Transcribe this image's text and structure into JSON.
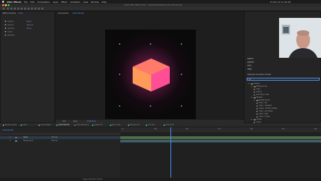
{
  "menubar": {
    "app_name": "After Effects",
    "items": [
      "File",
      "Edit",
      "Composition",
      "Layer",
      "Effect",
      "Animation",
      "View",
      "Window",
      "Help"
    ],
    "clock": "Fri Mar 22 11:04 AM"
  },
  "titlebar": {
    "title": "Adobe After Effects 2024 - /Users/Sam/Desktop/Cube Tutorial.aep"
  },
  "project_panel": {
    "tab_label": "Effect Controls",
    "layer_label": "Cube",
    "props": [
      {
        "label": "Fractal",
        "value": "None"
      },
      {
        "label": "Distort",
        "value": "Normal"
      },
      {
        "label": "Opacity",
        "value": "None"
      },
      {
        "label": "Scale",
        "value": ""
      },
      {
        "label": "Rotation",
        "value": "Rotation"
      }
    ]
  },
  "viewer": {
    "tab_label": "Composition",
    "sub_tab": "Cube Tutorial",
    "zoom": "50%",
    "resolution": "(Half)",
    "timecode": "0;00;03;02"
  },
  "right_panel": {
    "options": [
      "search",
      "perfect",
      "smh",
      "align"
    ],
    "section_title": "Selected Animation Preset",
    "search_value": "cu",
    "tree": [
      {
        "label": "Presets",
        "indent": 0,
        "kind": "folder"
      },
      {
        "label": "Backgrounds",
        "indent": 1,
        "kind": "folder"
      },
      {
        "label": "Cube",
        "indent": 2,
        "kind": "item"
      },
      {
        "label": "Cube 2",
        "indent": 2,
        "kind": "item"
      },
      {
        "label": "Geometry Cube",
        "indent": 2,
        "kind": "item"
      },
      {
        "label": "Shapes",
        "indent": 1,
        "kind": "folder"
      },
      {
        "label": "Backgrounds",
        "indent": 2,
        "kind": "folder"
      },
      {
        "label": "Cube - 3D",
        "indent": 3,
        "kind": "item"
      },
      {
        "label": "Cube - Gradient",
        "indent": 3,
        "kind": "item"
      },
      {
        "label": "Cubes - Hidden Shape",
        "indent": 3,
        "kind": "item"
      },
      {
        "label": "Cube - Iso Shape",
        "indent": 3,
        "kind": "item"
      },
      {
        "label": "Cube - Spin",
        "indent": 3,
        "kind": "item"
      },
      {
        "label": "Cube - 6 Side",
        "indent": 3,
        "kind": "item"
      },
      {
        "label": "Cubes",
        "indent": 1,
        "kind": "folder"
      },
      {
        "label": "Cubes",
        "indent": 2,
        "kind": "item"
      }
    ]
  },
  "timeline": {
    "tabs": [
      {
        "label": "Render Queue",
        "color": "#888888"
      },
      {
        "label": "Cube",
        "color": "#3aa0a0"
      },
      {
        "label": "Cube Rotate",
        "color": "#3aa0a0"
      },
      {
        "label": "Cube Tutorial",
        "color": "#3aa0a0"
      },
      {
        "label": "Cube Tutorial 2",
        "color": "#a04a8a"
      },
      {
        "label": "Cubes 3D",
        "color": "#3aa0a0"
      },
      {
        "label": "Spin Cube",
        "color": "#3aa0a0"
      },
      {
        "label": "Background",
        "color": "#3aa0a0"
      },
      {
        "label": "Iso Cube",
        "color": "#3aa0a0"
      },
      {
        "label": "Side Cube",
        "color": "#3aa0a0"
      }
    ],
    "timecode": "0;00;03;02",
    "layers": [
      {
        "num": "1",
        "name": "Cube",
        "mode": "Normal"
      },
      {
        "num": "2",
        "name": "Background",
        "mode": "Normal"
      }
    ],
    "ruler_labels": [
      "0s",
      "05s",
      "10s",
      "15s",
      "20s",
      "25s",
      "30s"
    ],
    "playhead": 0.25
  },
  "status": {
    "text": "Toggle Switches / Modes"
  },
  "colors": {
    "accent": "#4a90ff",
    "cube_top": "#ff6a5a",
    "cube_side": "#ff3e8a",
    "cube_front": "#ffb75a",
    "track_green": "#5e7c40"
  }
}
